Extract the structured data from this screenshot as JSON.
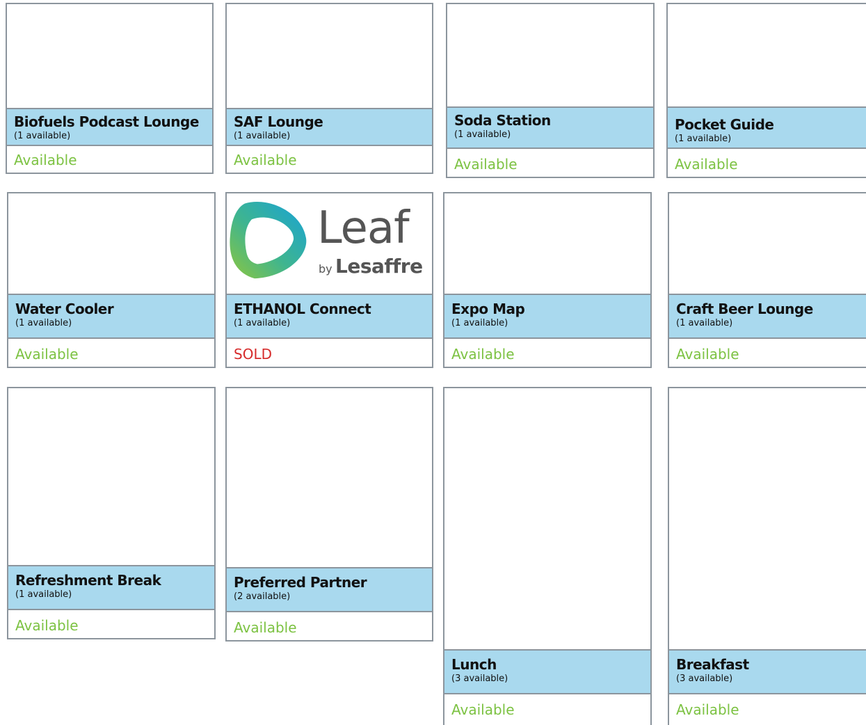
{
  "colors": {
    "border": "#8c959d",
    "title_bar": "#a9d9ee",
    "available": "#7cc242",
    "sold": "#d62b2b"
  },
  "cards": [
    {
      "title": "Biofuels Podcast Lounge",
      "qty": "(1 available)",
      "status": "Available"
    },
    {
      "title": "SAF Lounge",
      "qty": "(1 available)",
      "status": "Available"
    },
    {
      "title": "Soda Station",
      "qty": "(1 available)",
      "status": "Available"
    },
    {
      "title": "Pocket Guide",
      "qty": "(1 available)",
      "status": "Available"
    },
    {
      "title": "Water Cooler",
      "qty": "(1 available)",
      "status": "Available"
    },
    {
      "title": "ETHANOL Connect",
      "qty": "(1 available)",
      "status": "SOLD",
      "logo": {
        "icon": "leaf-by-lesaffre-logo",
        "text_main": "Leaf",
        "text_by": "by",
        "text_brand": "Lesaffre"
      }
    },
    {
      "title": "Expo Map",
      "qty": "(1 available)",
      "status": "Available"
    },
    {
      "title": "Craft Beer Lounge",
      "qty": "(1 available)",
      "status": "Available"
    },
    {
      "title": "Refreshment Break",
      "qty": "(1 available)",
      "status": "Available"
    },
    {
      "title": "Preferred Partner",
      "qty": "(2 available)",
      "status": "Available"
    },
    {
      "title": "Lunch",
      "qty": "(3 available)",
      "status": "Available"
    },
    {
      "title": "Breakfast",
      "qty": "(3 available)",
      "status": "Available"
    }
  ]
}
